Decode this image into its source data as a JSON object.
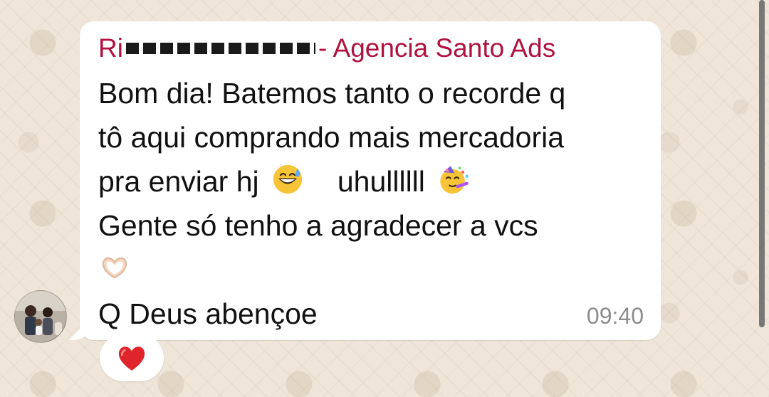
{
  "chat": {
    "sender": {
      "name_prefix": "Ri",
      "name_suffix": "- Agencia Santo Ads",
      "color": "#b0123f"
    },
    "message": {
      "lines": [
        "Bom dia! Batemos tanto o recorde q",
        "tô aqui comprando mais mercadoria",
        "pra enviar hj",
        "uhullllll",
        "Gente só tenho a agradecer a vcs",
        "Q Deus abençoe"
      ],
      "emojis": [
        "grinning-sweat-emoji",
        "partying-face-emoji",
        "heart-hands-emoji"
      ]
    },
    "timestamp": "09:40",
    "reaction": {
      "emoji_name": "red-heart-emoji",
      "color": "#e0242c"
    }
  }
}
